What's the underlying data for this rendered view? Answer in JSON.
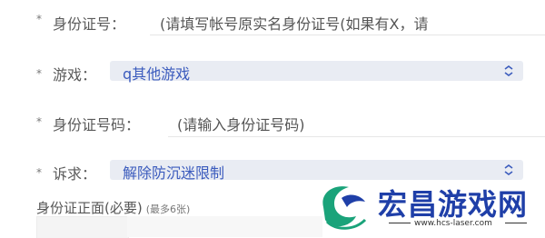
{
  "form": {
    "id_number": {
      "required_mark": "*",
      "label": "身份证号：",
      "value": "(请填写帐号原实名身份证号(如果有X，请"
    },
    "game": {
      "required_mark": "*",
      "label": "游戏：",
      "value": "q其他游戏"
    },
    "id_code": {
      "required_mark": "*",
      "label": "身份证号码：",
      "placeholder": "(请输入身份证号码)"
    },
    "request": {
      "required_mark": "*",
      "label": "诉求：",
      "value": "解除防沉迷限制"
    },
    "upload": {
      "title": "身份证正面(必要)",
      "hint": "(最多6张)"
    }
  },
  "watermark": {
    "text": "宏昌游戏网",
    "url": "www.hcs-laser.com"
  },
  "colors": {
    "select_bg": "#e9ecf3",
    "select_text": "#3b5bbd",
    "brand_blue": "#1f3fa8",
    "brand_green": "#1aa37a"
  }
}
